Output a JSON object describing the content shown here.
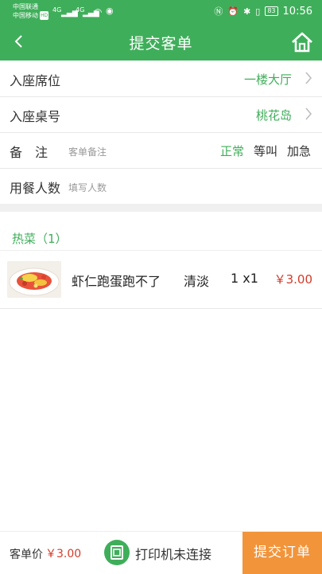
{
  "status_bar": {
    "carrier1": "中国联通",
    "carrier2": "中国移动",
    "hd_tag": "HD",
    "net1": "4G",
    "net2": "4G",
    "battery": "83",
    "time": "10:56"
  },
  "header": {
    "title": "提交客单"
  },
  "seat": {
    "label": "入座席位",
    "value": "一楼大厅"
  },
  "table": {
    "label": "入座桌号",
    "value": "桃花岛"
  },
  "remark": {
    "label": "备　注",
    "placeholder": "客单备注",
    "options": [
      "正常",
      "等叫",
      "加急"
    ],
    "selected": "正常"
  },
  "diners": {
    "label": "用餐人数",
    "placeholder": "填写人数"
  },
  "order": {
    "category": "热菜（1）",
    "items": [
      {
        "name": "虾仁跑蛋跑不了",
        "taste": "清淡",
        "qty": "1 x1",
        "price": "￥3.00",
        "icon": "dish-photo"
      }
    ]
  },
  "footer": {
    "total_label": "客单价",
    "total_value": "￥3.00",
    "printer_status": "打印机未连接",
    "submit_label": "提交订单"
  },
  "colors": {
    "primary": "#3fae5a",
    "accent": "#f2943a",
    "price": "#d23b2a"
  }
}
